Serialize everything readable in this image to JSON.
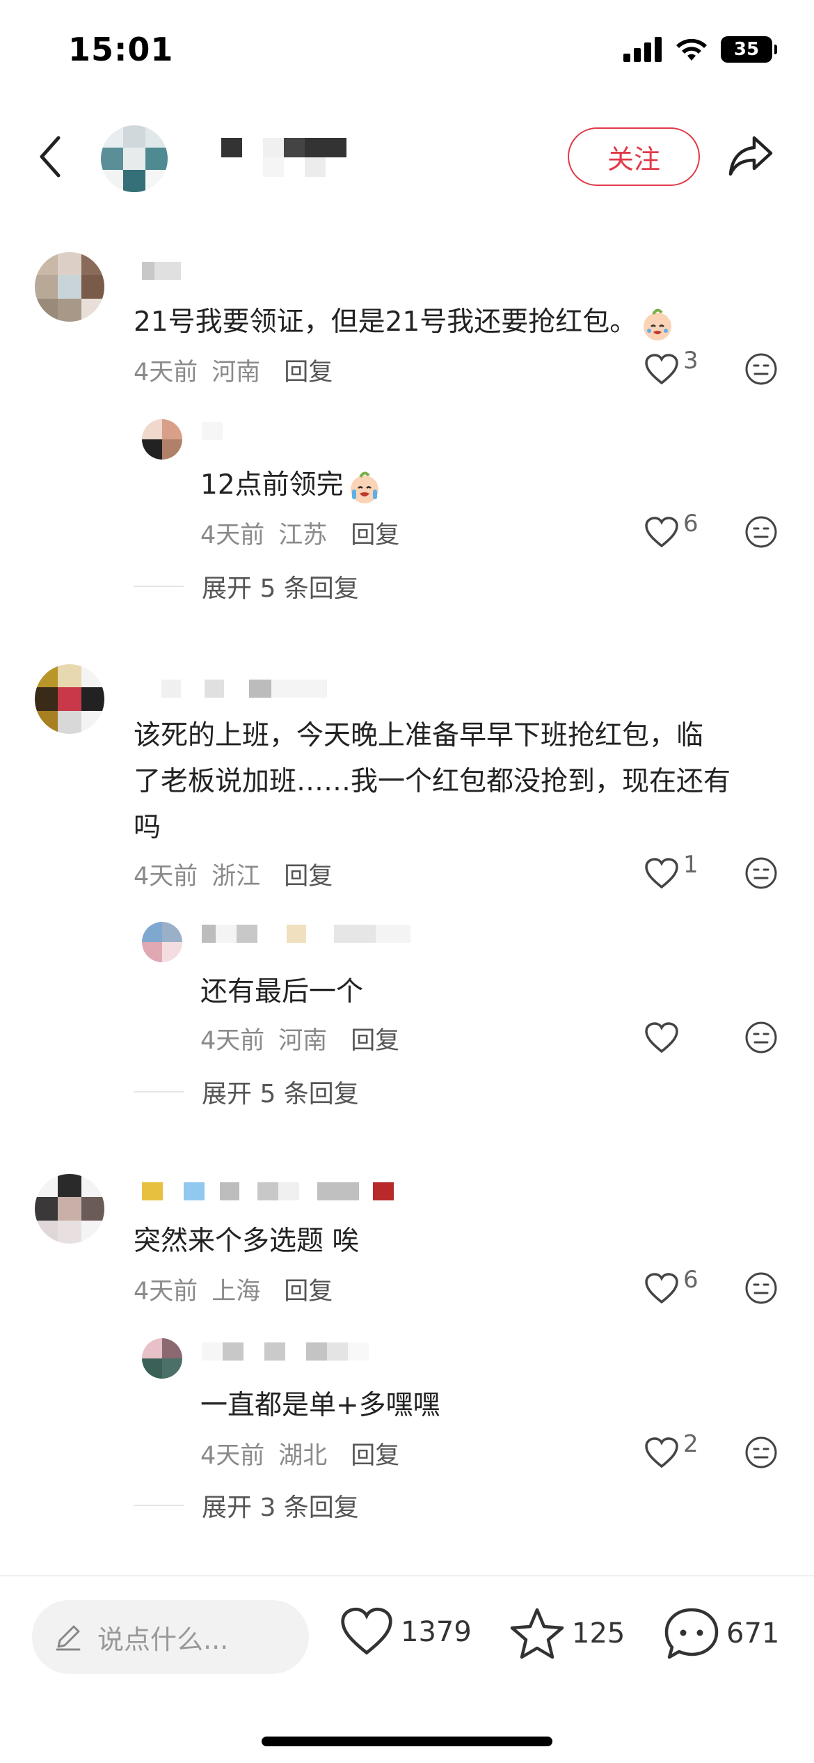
{
  "status_bar": {
    "time": "15:01",
    "battery": "35"
  },
  "header": {
    "follow_label": "关注"
  },
  "comments": [
    {
      "text": "21号我要领证，但是21号我还要抢红包。",
      "time": "4天前",
      "location": "河南",
      "reply_label": "回复",
      "likes": "3",
      "sub_reply": {
        "text": "12点前领完",
        "time": "4天前",
        "location": "江苏",
        "reply_label": "回复",
        "likes": "6"
      },
      "expand_label": "展开 5 条回复"
    },
    {
      "text_line1": "该死的上班，今天晚上准备早早下班抢红包，临",
      "text_line2": "了老板说加班……我一个红包都没抢到，现在还有",
      "text_line3": "吗",
      "time": "4天前",
      "location": "浙江",
      "reply_label": "回复",
      "likes": "1",
      "sub_reply": {
        "text": "还有最后一个",
        "time": "4天前",
        "location": "河南",
        "reply_label": "回复",
        "likes": ""
      },
      "expand_label": "展开 5 条回复"
    },
    {
      "text": "突然来个多选题 唉",
      "time": "4天前",
      "location": "上海",
      "reply_label": "回复",
      "likes": "6",
      "sub_reply": {
        "text": "一直都是单+多嘿嘿",
        "time": "4天前",
        "location": "湖北",
        "reply_label": "回复",
        "likes": "2"
      },
      "expand_label": "展开 3 条回复"
    }
  ],
  "bottom_bar": {
    "placeholder": "说点什么...",
    "likes": "1379",
    "favorites": "125",
    "comments": "671"
  },
  "icons": {
    "back": "back-arrow-icon",
    "share": "share-icon",
    "heart": "heart-icon",
    "dislike": "dislike-face-icon",
    "star": "star-icon",
    "comment": "comment-bubble-icon",
    "pencil": "pencil-icon"
  },
  "colors": {
    "accent": "#e23a4a",
    "meta_gray": "#8a8a8a"
  }
}
